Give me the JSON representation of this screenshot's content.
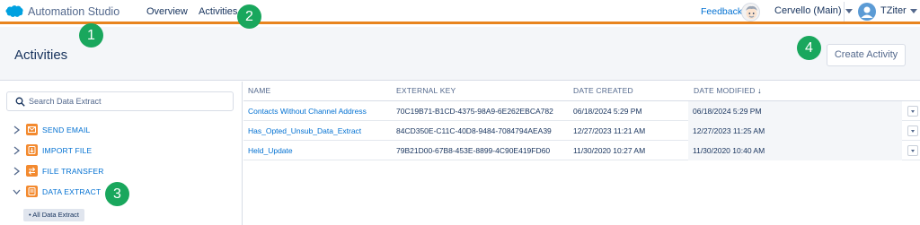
{
  "app": {
    "title": "Automation Studio"
  },
  "nav": {
    "overview": "Overview",
    "activities": "Activities"
  },
  "topbar": {
    "feedback": "Feedback",
    "business_unit": "Cervello (Main)",
    "user_name": "TZiter"
  },
  "page": {
    "title": "Activities",
    "create_button": "Create Activity"
  },
  "search": {
    "placeholder": "Search Data Extract"
  },
  "sidebar": {
    "items": [
      {
        "label": "SEND EMAIL",
        "icon": "email-icon",
        "expanded": false
      },
      {
        "label": "IMPORT FILE",
        "icon": "import-file-icon",
        "expanded": false
      },
      {
        "label": "FILE TRANSFER",
        "icon": "file-transfer-icon",
        "expanded": false
      },
      {
        "label": "DATA EXTRACT",
        "icon": "data-extract-icon",
        "expanded": true
      }
    ],
    "selected_filter": "All Data Extract"
  },
  "table": {
    "columns": [
      "NAME",
      "EXTERNAL KEY",
      "DATE CREATED",
      "DATE MODIFIED"
    ],
    "sort_indicator": "↓",
    "rows": [
      {
        "name": "Contacts Without Channel Address",
        "key": "70C19B71-B1CD-4375-98A9-6E262EBCA782",
        "created": "06/18/2024 5:29 PM",
        "modified": "06/18/2024 5:29 PM"
      },
      {
        "name": "Has_Opted_Unsub_Data_Extract",
        "key": "84CD350E-C11C-40D8-9484-7084794AEA39",
        "created": "12/27/2023 11:21 AM",
        "modified": "12/27/2023 11:25 AM"
      },
      {
        "name": "Held_Update",
        "key": "79B21D00-67B8-453E-8899-4C90E419FD60",
        "created": "11/30/2020 10:27 AM",
        "modified": "11/30/2020 10:40 AM"
      }
    ]
  },
  "annotations": [
    "1",
    "2",
    "3",
    "4"
  ],
  "colors": {
    "accent": "#e8841f",
    "link": "#0070d2",
    "badge": "#19a75d",
    "activity_icon": "#f38a2f"
  }
}
